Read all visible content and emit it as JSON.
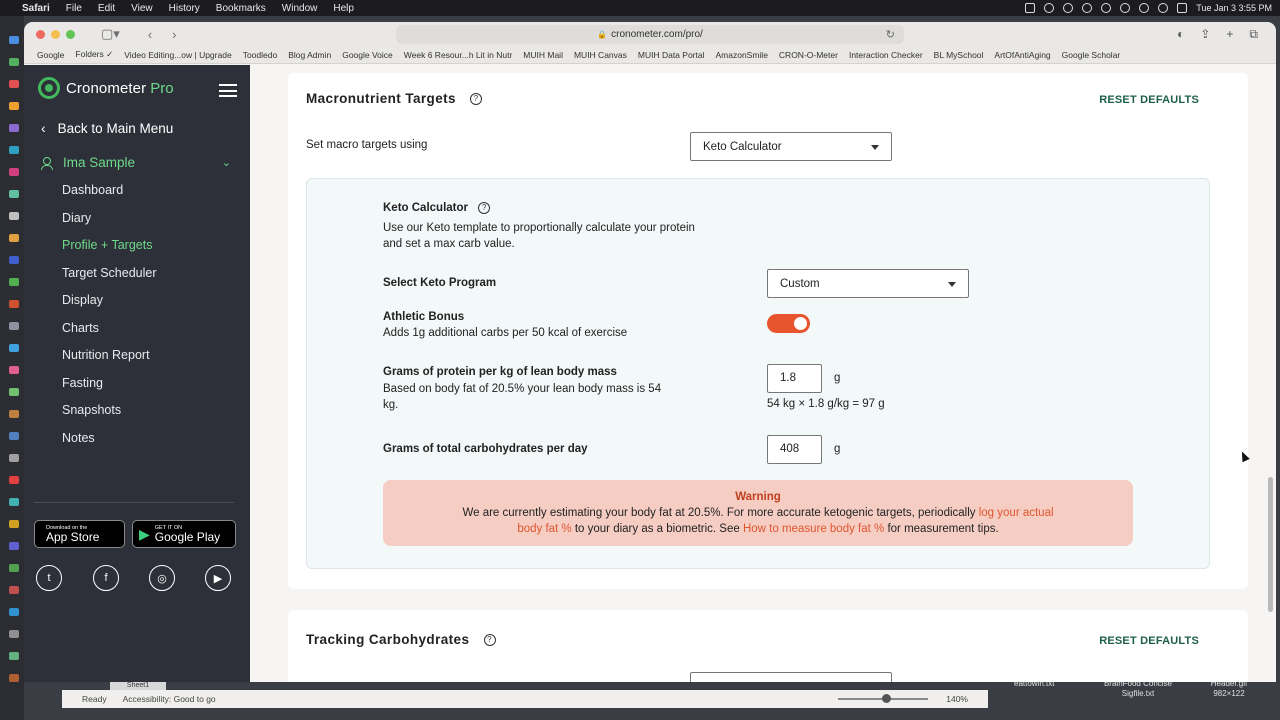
{
  "menubar": {
    "app": "Safari",
    "items": [
      "File",
      "Edit",
      "View",
      "History",
      "Bookmarks",
      "Window",
      "Help"
    ],
    "clock": "Tue Jan 3  3:55 PM"
  },
  "browser": {
    "url": "cronometer.com/pro/",
    "bookmarks": [
      "Google",
      "Folders ✓",
      "Video Editing...ow | Upgrade",
      "Toodledo",
      "Blog Admin",
      "Google Voice",
      "Week 6 Resour...h Lit in Nutr",
      "MUIH Mail",
      "MUIH Canvas",
      "MUIH Data Portal",
      "AmazonSmile",
      "CRON-O-Meter",
      "Interaction Checker",
      "BL MySchool",
      "ArtOfAntiAging",
      "Google Scholar"
    ]
  },
  "sidebar": {
    "brand": "Cronometer",
    "brand_suffix": "Pro",
    "back_label": "Back to Main Menu",
    "profile_name": "Ima Sample",
    "items": [
      {
        "label": "Dashboard",
        "active": false
      },
      {
        "label": "Diary",
        "active": false
      },
      {
        "label": "Profile + Targets",
        "active": true
      },
      {
        "label": "Target Scheduler",
        "active": false
      },
      {
        "label": "Display",
        "active": false
      },
      {
        "label": "Charts",
        "active": false
      },
      {
        "label": "Nutrition Report",
        "active": false
      },
      {
        "label": "Fasting",
        "active": false
      },
      {
        "label": "Snapshots",
        "active": false
      },
      {
        "label": "Notes",
        "active": false
      }
    ],
    "appstore": {
      "small": "Download on the",
      "big": "App Store"
    },
    "googleplay": {
      "small": "GET IT ON",
      "big": "Google Play"
    }
  },
  "macro": {
    "title": "Macronutrient Targets",
    "reset_label": "RESET DEFAULTS",
    "set_label": "Set macro targets using",
    "set_value": "Keto Calculator",
    "keto": {
      "title": "Keto Calculator",
      "desc_line1": "Use our Keto template to proportionally calculate your protein",
      "desc_line2": "and set a max carb value.",
      "program_label": "Select Keto Program",
      "program_value": "Custom",
      "athletic_label": "Athletic Bonus",
      "athletic_desc": "Adds 1g additional carbs per 50 kcal of exercise",
      "athletic_on": true,
      "protein_label": "Grams of protein per kg of lean body mass",
      "protein_desc_line1": "Based on body fat of 20.5% your lean body mass is 54",
      "protein_desc_line2": "kg.",
      "protein_value": "1.8",
      "protein_unit": "g",
      "protein_calc": "54 kg × 1.8 g/kg = 97 g",
      "carb_label": "Grams of total carbohydrates per day",
      "carb_value": "408",
      "carb_unit": "g"
    },
    "warning": {
      "title": "Warning",
      "text1": "We are currently estimating your body fat at 20.5%. For more accurate ketogenic targets, periodically",
      "link1a": "log your actual",
      "link1b": "body fat %",
      "text2": "to your diary as a biometric. See",
      "link2": "How to measure body fat %",
      "text3": "for measurement tips."
    }
  },
  "carbs": {
    "title": "Tracking Carbohydrates",
    "reset_label": "RESET DEFAULTS"
  },
  "background": {
    "status": "Ready",
    "accessibility": "Accessibility: Good to go",
    "zoom": "140%",
    "sheet_tab": "Sheet1",
    "desktop_files": [
      "eattowin.txt",
      "BrainFood Concise Sigfile.txt",
      "Header.gif 982×122"
    ]
  },
  "colors": {
    "accent_green": "#6fd98a",
    "toggle_orange": "#e8542d",
    "reset_green": "#1d5e4a",
    "warning_bg": "#f6cdc3"
  }
}
